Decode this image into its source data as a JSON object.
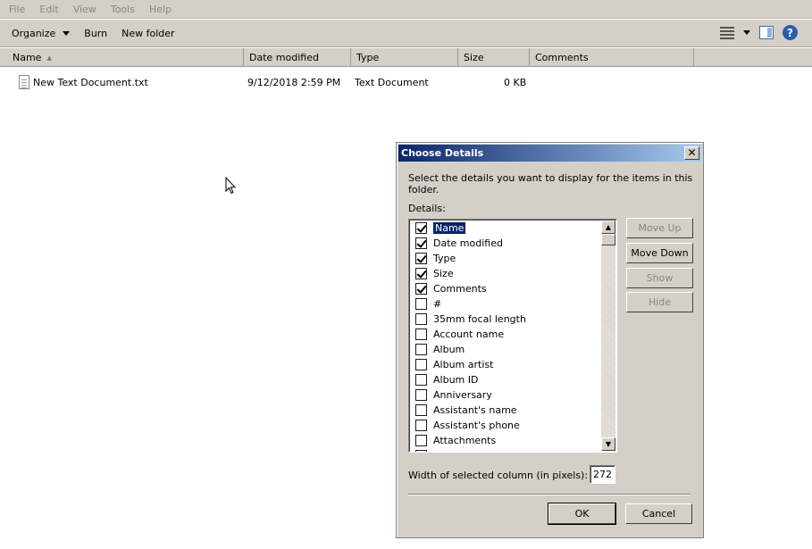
{
  "menu": [
    "File",
    "Edit",
    "View",
    "Tools",
    "Help"
  ],
  "toolbar": {
    "organize": "Organize",
    "burn": "Burn",
    "new_folder": "New folder"
  },
  "columns": {
    "name": "Name",
    "date_modified": "Date modified",
    "type": "Type",
    "size": "Size",
    "comments": "Comments"
  },
  "files": [
    {
      "name": "New Text Document.txt",
      "date_modified": "9/12/2018 2:59 PM",
      "type": "Text Document",
      "size": "0 KB"
    }
  ],
  "dialog": {
    "title": "Choose Details",
    "close": "✕",
    "description": "Select the details you want to display for the items in this folder.",
    "details_label": "Details:",
    "items": [
      {
        "label": "Name",
        "checked": true,
        "selected": true
      },
      {
        "label": "Date modified",
        "checked": true
      },
      {
        "label": "Type",
        "checked": true
      },
      {
        "label": "Size",
        "checked": true
      },
      {
        "label": "Comments",
        "checked": true
      },
      {
        "label": "#",
        "checked": false
      },
      {
        "label": "35mm focal length",
        "checked": false
      },
      {
        "label": "Account name",
        "checked": false
      },
      {
        "label": "Album",
        "checked": false
      },
      {
        "label": "Album artist",
        "checked": false
      },
      {
        "label": "Album ID",
        "checked": false
      },
      {
        "label": "Anniversary",
        "checked": false
      },
      {
        "label": "Assistant's name",
        "checked": false
      },
      {
        "label": "Assistant's phone",
        "checked": false
      },
      {
        "label": "Attachments",
        "checked": false
      }
    ],
    "buttons": {
      "move_up": "Move Up",
      "move_down": "Move Down",
      "show": "Show",
      "hide": "Hide",
      "ok": "OK",
      "cancel": "Cancel"
    },
    "width_label": "Width of selected column (in pixels):",
    "width_value": "272"
  }
}
